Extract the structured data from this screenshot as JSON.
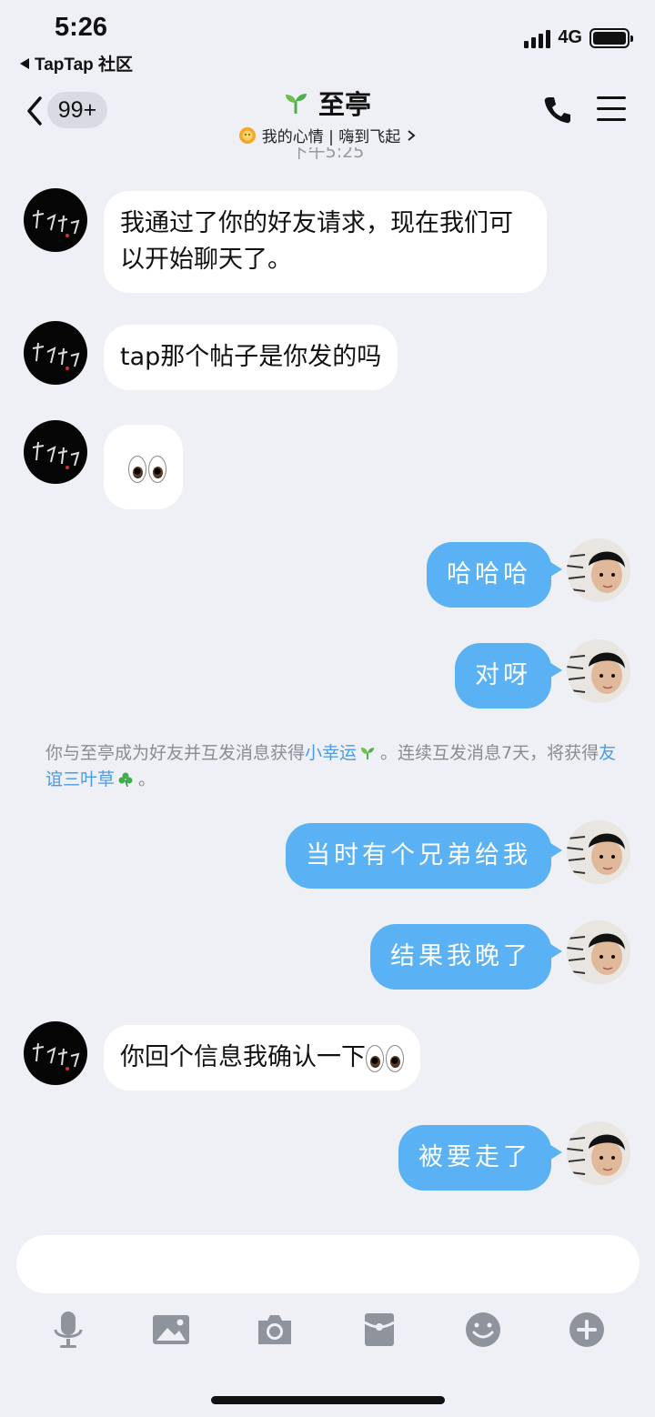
{
  "status_bar": {
    "time": "5:26",
    "back_app": "TapTap 社区",
    "network": "4G"
  },
  "header": {
    "unread_count": "99+",
    "contact_name": "至亭",
    "mood_text": "我的心情 | 嗨到飞起"
  },
  "time_divider": "下午5:25",
  "messages": [
    {
      "side": "in",
      "text": "我通过了你的好友请求，现在我们可以开始聊天了。"
    },
    {
      "side": "in",
      "text": "tap那个帖子是你发的吗"
    },
    {
      "side": "in",
      "text": "👀"
    },
    {
      "side": "out",
      "text": "哈哈哈"
    },
    {
      "side": "out",
      "text": "对呀"
    },
    {
      "side": "out",
      "text": "当时有个兄弟给我"
    },
    {
      "side": "out",
      "text": "结果我晚了"
    },
    {
      "side": "in",
      "text": "你回个信息我确认一下👀"
    },
    {
      "side": "out",
      "text": "被要走了"
    }
  ],
  "system_note": {
    "part1": "你与至亭成为好友并互发消息获得",
    "link1": "小幸运",
    "part2": "。连续互发消息7天，将获得",
    "link2": "友谊三叶草",
    "part3": "。"
  },
  "colors": {
    "outgoing_bubble": "#5ab1f3",
    "incoming_bubble": "#ffffff",
    "background": "#eff0f5",
    "link": "#4a9be6"
  },
  "toolbar_icons": [
    "mic-icon",
    "image-icon",
    "camera-icon",
    "red-packet-icon",
    "emoji-icon",
    "plus-icon"
  ]
}
